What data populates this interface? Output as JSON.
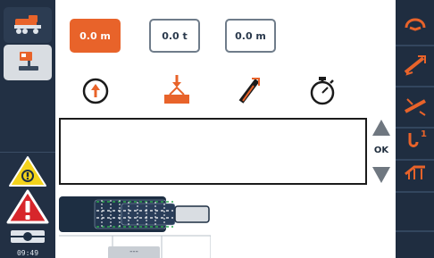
{
  "readouts": [
    {
      "value": "0.0 m",
      "style": "primary"
    },
    {
      "value": "0.0 t",
      "style": "secondary"
    },
    {
      "value": "0.0 m",
      "style": "secondary"
    }
  ],
  "mode_icons": [
    "radius-clock-icon",
    "hook-load-icon",
    "boom-length-icon",
    "stopwatch-icon"
  ],
  "message": "",
  "ok_label": "OK",
  "clock": "09:49",
  "bottom_tab_label": "---",
  "left_toolbar": [
    "truck-icon",
    "crane-operator-icon",
    "warning-indicator-icon",
    "alarm-icon",
    "level-indicator-icon"
  ],
  "right_toolbar": [
    "hook-rotate-icon",
    "boom-telescope-icon",
    "boom-angle-icon",
    "hook-count-icon",
    "outrigger-icon"
  ],
  "colors": {
    "accent": "#e8632a",
    "sidebar": "#223044",
    "warning_yellow": "#f4d31c",
    "alarm_red": "#d7262b",
    "boom_dark": "#1d2e42",
    "green_dash": "#2fa84f"
  }
}
